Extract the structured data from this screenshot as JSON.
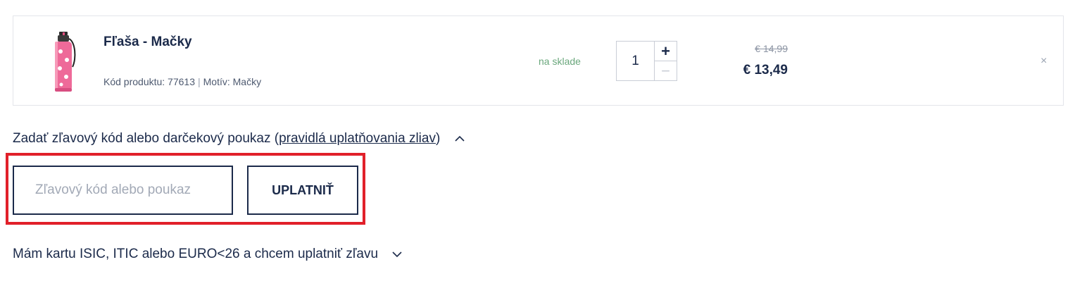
{
  "cart": {
    "item": {
      "name": "Fľaša - Mačky",
      "code_label": "Kód produktu: 77613",
      "motif_label": "Motív: Mačky",
      "separator": "|",
      "stock": "na sklade",
      "quantity": "1",
      "plus": "+",
      "minus": "−",
      "old_price": "€ 14,99",
      "price": "€ 13,49",
      "remove": "×",
      "image_icon": "water-bottle-image"
    }
  },
  "discount": {
    "toggle_text": "Zadať zľavový kód alebo darčekový poukaz (",
    "rules_link": "pravidlá uplatňovania zliav",
    "toggle_close": ")",
    "chevron": "chevron-up-icon",
    "input_placeholder": "Zľavový kód alebo poukaz",
    "input_value": "",
    "apply_label": "UPLATNIŤ",
    "highlight_color": "#e1202a"
  },
  "isic": {
    "toggle_text": "Mám kartu ISIC, ITIC alebo EURO<26 a chcem uplatniť zľavu",
    "chevron": "chevron-down-icon"
  }
}
